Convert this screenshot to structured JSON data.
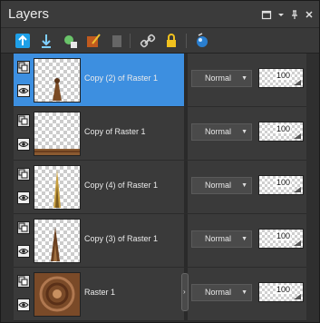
{
  "panel": {
    "title": "Layers"
  },
  "titlebar_buttons": [
    {
      "name": "restore-window-icon",
      "glyph": "▫"
    },
    {
      "name": "dropdown-menu-icon",
      "glyph": "▾"
    },
    {
      "name": "pin-icon",
      "glyph": "⊥"
    },
    {
      "name": "close-icon",
      "glyph": "✕"
    }
  ],
  "toolbar": {
    "tools": [
      {
        "name": "new-raster-layer-icon"
      },
      {
        "name": "new-vector-layer-icon"
      },
      {
        "name": "new-adjustment-layer-icon"
      },
      {
        "name": "edit-layer-icon"
      },
      {
        "name": "delete-layer-icon"
      },
      {
        "name": "link-layers-icon"
      },
      {
        "name": "lock-layer-icon"
      },
      {
        "name": "layer-visibility-toggle-icon"
      }
    ]
  },
  "layers": [
    {
      "name": "Copy (2) of Raster 1",
      "blend_mode": "Normal",
      "opacity": "100",
      "selected": true,
      "thumb": "small-figure"
    },
    {
      "name": "Copy of Raster 1",
      "blend_mode": "Normal",
      "opacity": "100",
      "selected": false,
      "thumb": "bottom-strip"
    },
    {
      "name": "Copy (4) of Raster 1",
      "blend_mode": "Normal",
      "opacity": "100",
      "selected": false,
      "thumb": "tall-spire"
    },
    {
      "name": "Copy (3) of Raster 1",
      "blend_mode": "Normal",
      "opacity": "100",
      "selected": false,
      "thumb": "dark-spire"
    },
    {
      "name": "Raster 1",
      "blend_mode": "Normal",
      "opacity": "100",
      "selected": false,
      "thumb": "full-texture"
    }
  ],
  "colors": {
    "selected_row": "#3d8fe0",
    "panel_bg": "#2f2f2f"
  }
}
